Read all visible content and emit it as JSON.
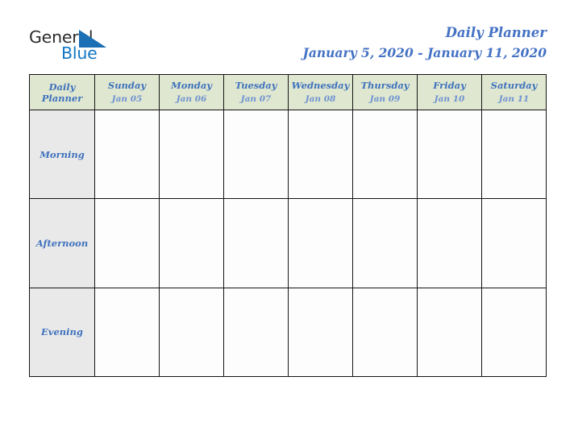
{
  "brand": {
    "name_part1": "General",
    "name_part2": "Blue",
    "triangle_icon": "triangle-icon",
    "colors": {
      "dark_text": "#2b2b2b",
      "blue": "#1277c4"
    }
  },
  "header": {
    "title": "Daily Planner",
    "date_range": "January 5, 2020 - January 11, 2020",
    "title_color": "#4472c4"
  },
  "planner": {
    "corner_label_line1": "Daily",
    "corner_label_line2": "Planner",
    "header_bg": "#dfe7d0",
    "row_label_bg": "#e9e9e9",
    "cell_bg": "#fdfdfd",
    "border_color": "#141414",
    "day_name_color": "#3f72bd",
    "day_date_color": "#6f93d0",
    "columns": [
      {
        "day": "Sunday",
        "date": "Jan 05"
      },
      {
        "day": "Monday",
        "date": "Jan 06"
      },
      {
        "day": "Tuesday",
        "date": "Jan 07"
      },
      {
        "day": "Wednesday",
        "date": "Jan 08"
      },
      {
        "day": "Thursday",
        "date": "Jan 09"
      },
      {
        "day": "Friday",
        "date": "Jan 10"
      },
      {
        "day": "Saturday",
        "date": "Jan 11"
      }
    ],
    "rows": [
      {
        "label": "Morning",
        "cells": [
          "",
          "",
          "",
          "",
          "",
          "",
          ""
        ]
      },
      {
        "label": "Afternoon",
        "cells": [
          "",
          "",
          "",
          "",
          "",
          "",
          ""
        ]
      },
      {
        "label": "Evening",
        "cells": [
          "",
          "",
          "",
          "",
          "",
          "",
          ""
        ]
      }
    ]
  }
}
